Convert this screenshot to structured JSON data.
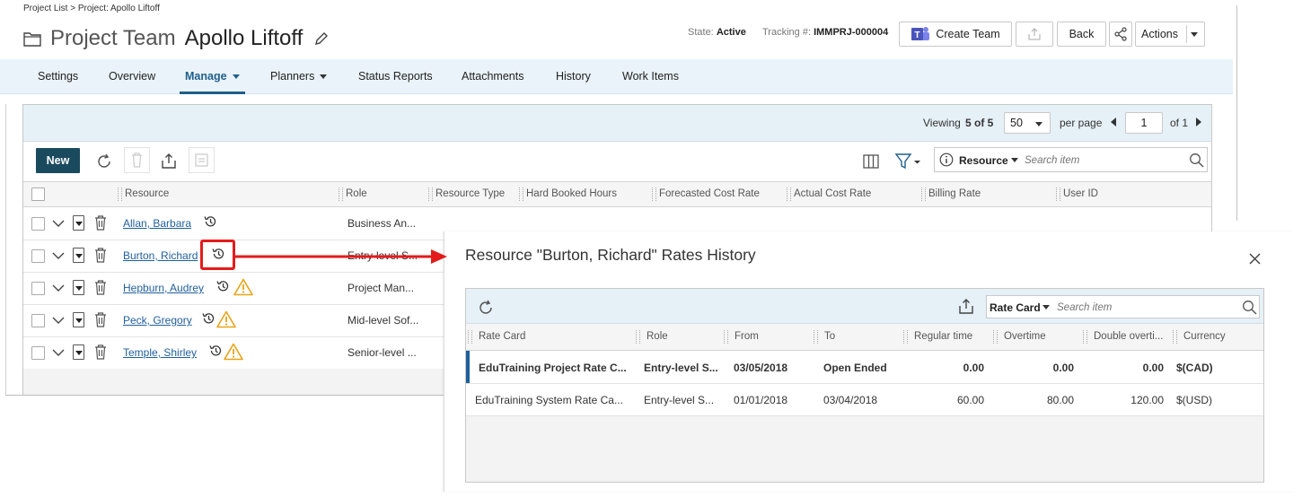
{
  "breadcrumb": "Project List > Project: Apollo Liftoff",
  "header": {
    "prefix": "Project Team",
    "name": "Apollo Liftoff",
    "state_label": "State:",
    "state_value": "Active",
    "tracking_label": "Tracking #:",
    "tracking_value": "IMMPRJ-000004",
    "create_team": "Create Team",
    "back": "Back",
    "actions": "Actions"
  },
  "tabs": [
    "Settings",
    "Overview",
    "Manage",
    "Planners",
    "Status Reports",
    "Attachments",
    "History",
    "Work Items"
  ],
  "pagination": {
    "viewing_label": "Viewing",
    "viewing_range": "5 of 5",
    "per_page_value": "50",
    "per_page_label": "per page",
    "page": "1",
    "of_label": "of 1"
  },
  "toolbar": {
    "new": "New",
    "search_field": "Resource",
    "search_placeholder": "Search item"
  },
  "columns": [
    "Resource",
    "Role",
    "Resource Type",
    "Hard Booked Hours",
    "Forecasted Cost Rate",
    "Actual Cost Rate",
    "Billing Rate",
    "User ID"
  ],
  "rows": [
    {
      "name": "Allan, Barbara",
      "role": "Business An...",
      "warning": false
    },
    {
      "name": "Burton, Richard",
      "role": "Entry-level S...",
      "warning": false
    },
    {
      "name": "Hepburn, Audrey",
      "role": "Project Man...",
      "warning": true
    },
    {
      "name": "Peck, Gregory",
      "role": "Mid-level Sof...",
      "warning": true
    },
    {
      "name": "Temple, Shirley",
      "role": "Senior-level ...",
      "warning": true
    }
  ],
  "modal": {
    "title": "Resource \"Burton, Richard\" Rates History",
    "search_field": "Rate Card",
    "search_placeholder": "Search item",
    "columns": [
      "Rate Card",
      "Role",
      "From",
      "To",
      "Regular time",
      "Overtime",
      "Double overti...",
      "Currency"
    ],
    "rows": [
      {
        "rate_card": "EduTraining Project Rate C...",
        "role": "Entry-level S...",
        "from": "03/05/2018",
        "to": "Open Ended",
        "regular": "0.00",
        "overtime": "0.00",
        "double": "0.00",
        "currency": "$(CAD)",
        "current": true
      },
      {
        "rate_card": "EduTraining System Rate Ca...",
        "role": "Entry-level S...",
        "from": "01/01/2018",
        "to": "03/04/2018",
        "regular": "60.00",
        "overtime": "80.00",
        "double": "120.00",
        "currency": "$(USD)",
        "current": false
      }
    ]
  },
  "colors": {
    "accent": "#1f5f8b",
    "new_button": "#1a4a5e",
    "highlight": "#e41b1b",
    "warning": "#e8a317"
  }
}
